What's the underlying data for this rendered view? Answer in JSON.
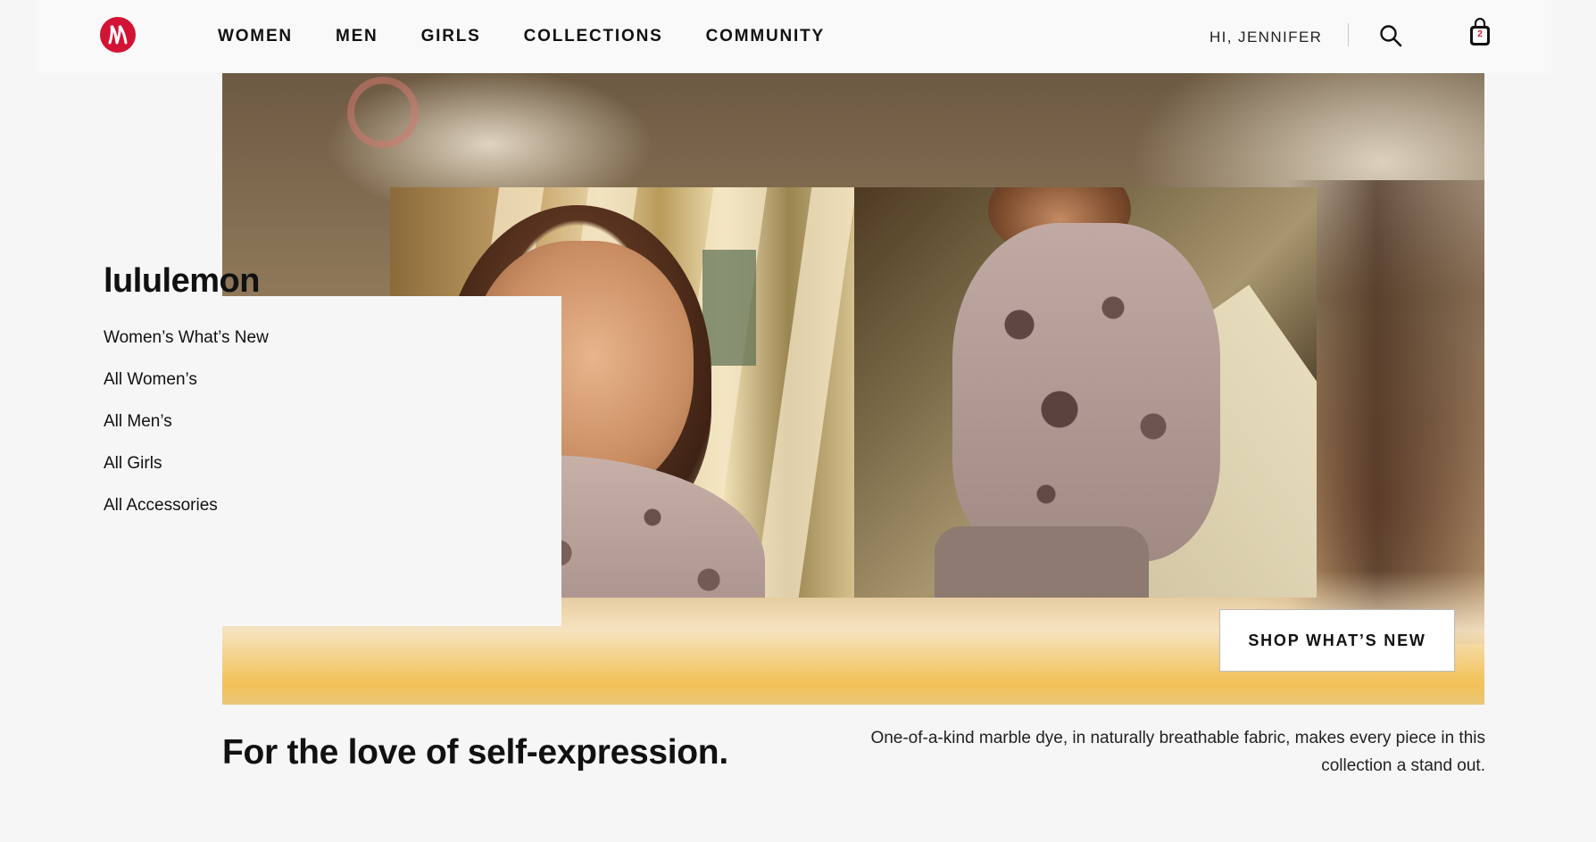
{
  "header": {
    "logo": "lululemon-logo",
    "nav": [
      {
        "label": "WOMEN"
      },
      {
        "label": "MEN"
      },
      {
        "label": "GIRLS"
      },
      {
        "label": "COLLECTIONS"
      },
      {
        "label": "COMMUNITY"
      }
    ],
    "greeting": "HI, JENNIFER",
    "search_icon": "search-icon",
    "bag_icon": "shopping-bag-icon",
    "bag_count": "2"
  },
  "hero": {
    "brand_title": "lululemon",
    "links": [
      {
        "label": "Women’s What’s New"
      },
      {
        "label": "All Women’s"
      },
      {
        "label": "All Men’s"
      },
      {
        "label": "All Girls"
      },
      {
        "label": "All Accessories"
      }
    ],
    "cta_label": "SHOP WHAT’S NEW"
  },
  "main": {
    "headline": "For the love of self-expression.",
    "description": "One-of-a-kind marble dye, in naturally breathable fabric, makes every piece in this collection a stand out."
  },
  "colors": {
    "brand_red": "#d31334",
    "text": "#111111",
    "background": "#f6f6f6"
  }
}
